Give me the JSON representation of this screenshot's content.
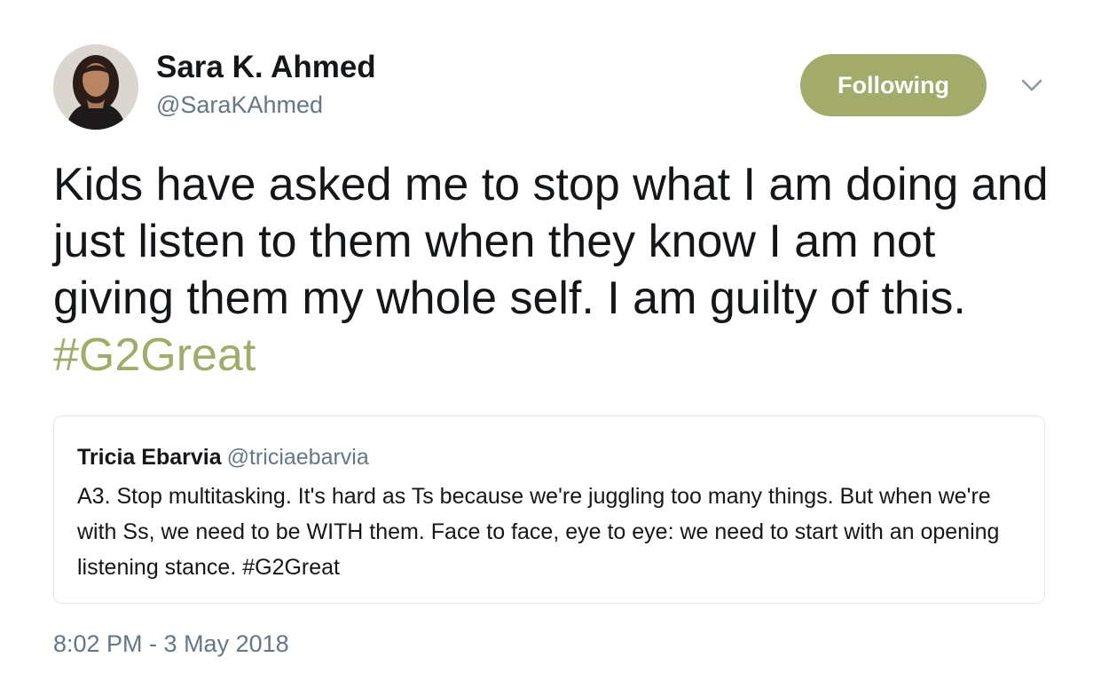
{
  "colors": {
    "accent": "#a3ab6b",
    "text_primary": "#14171a",
    "text_secondary": "#657786",
    "border": "#e1e8ed"
  },
  "author": {
    "display_name": "Sara K. Ahmed",
    "handle": "@SaraKAhmed",
    "avatar_icon": "profile-photo"
  },
  "actions": {
    "follow_label": "Following",
    "menu_icon": "chevron-down-icon"
  },
  "tweet": {
    "text": "Kids have asked me to stop what I am doing and just listen to them when they know I am not giving them my whole self. I am guilty of this. ",
    "hashtag": "#G2Great"
  },
  "quoted_tweet": {
    "display_name": "Tricia Ebarvia",
    "handle": "@triciaebarvia",
    "text": "A3. Stop multitasking. It's hard as Ts because we're juggling too many things. But when we're with Ss, we need to be WITH them. Face to face, eye to eye: we need to start with an opening listening stance. #G2Great"
  },
  "timestamp": "8:02 PM - 3 May 2018"
}
